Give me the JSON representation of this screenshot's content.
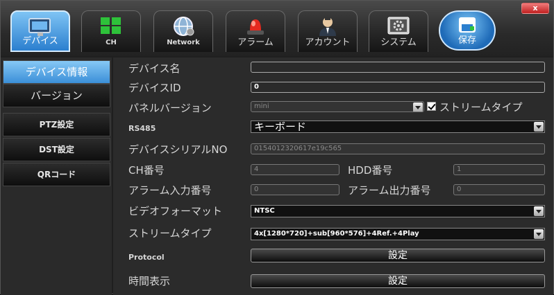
{
  "window": {
    "close_label": "x"
  },
  "tabs": [
    {
      "label": "デバイス",
      "icon": "monitor-icon"
    },
    {
      "label": "CH",
      "icon": "channel-grid-icon"
    },
    {
      "label": "Network",
      "icon": "network-globe-icon"
    },
    {
      "label": "アラーム",
      "icon": "alarm-siren-icon"
    },
    {
      "label": "アカウント",
      "icon": "user-account-icon"
    },
    {
      "label": "システム",
      "icon": "system-gear-icon"
    },
    {
      "label": "保存",
      "icon": "save-disk-icon"
    }
  ],
  "sidebar": {
    "items": [
      {
        "label": "デバイス情報"
      },
      {
        "label": "バージョン"
      },
      {
        "label": "PTZ設定"
      },
      {
        "label": "DST設定"
      },
      {
        "label": "QRコード"
      }
    ]
  },
  "form": {
    "device_name": {
      "label": "デバイス名",
      "value": ""
    },
    "device_id": {
      "label": "デバイスID",
      "value": "0"
    },
    "panel_version": {
      "label": "パネルバージョン",
      "value": "mini"
    },
    "stream_type_check": {
      "label": "ストリームタイプ",
      "checked": true
    },
    "rs485": {
      "label": "RS485",
      "value": "キーボード"
    },
    "serial_no": {
      "label": "デバイスシリアルNO",
      "value": "0154012320617e19c565"
    },
    "ch_count": {
      "label": "CH番号",
      "value": "4"
    },
    "hdd_count": {
      "label": "HDD番号",
      "value": "1"
    },
    "alarm_in": {
      "label": "アラーム入力番号",
      "value": "0"
    },
    "alarm_out": {
      "label": "アラーム出力番号",
      "value": "0"
    },
    "video_format": {
      "label": "ビデオフォーマット",
      "value": "NTSC"
    },
    "stream_type": {
      "label": "ストリームタイプ",
      "value": "4x[1280*720]+sub[960*576]+4Ref.+4Play"
    },
    "protocol": {
      "label": "Protocol",
      "button": "設定"
    },
    "time_display": {
      "label": "時間表示",
      "button": "設定"
    }
  }
}
